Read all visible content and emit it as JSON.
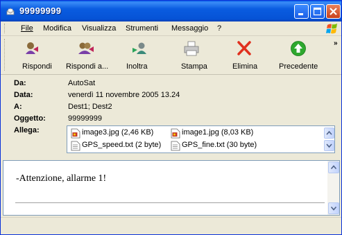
{
  "window": {
    "title": "99999999",
    "icon": "envelope-icon",
    "controls": [
      "minimize-icon",
      "maximize-icon",
      "close-icon"
    ]
  },
  "menu": {
    "items": [
      "File",
      "Modifica",
      "Visualizza",
      "Strumenti",
      "Messaggio",
      "?"
    ]
  },
  "toolbar": {
    "buttons": [
      {
        "label": "Rispondi",
        "icon": "reply-icon"
      },
      {
        "label": "Rispondi a...",
        "icon": "reply-all-icon"
      },
      {
        "label": "Inoltra",
        "icon": "forward-icon"
      },
      {
        "label": "Stampa",
        "icon": "printer-icon"
      },
      {
        "label": "Elimina",
        "icon": "delete-x-icon"
      },
      {
        "label": "Precedente",
        "icon": "previous-arrow-icon"
      }
    ],
    "overflow": "»"
  },
  "header": {
    "from_label": "Da:",
    "from_value": "AutoSat",
    "date_label": "Data:",
    "date_value": "venerdì 11 novembre 2005 13.24",
    "to_label": "A:",
    "to_value": "Dest1; Dest2",
    "subject_label": "Oggetto:",
    "subject_value": "99999999",
    "attach_label": "Allega:"
  },
  "attachments": [
    {
      "name": "image3.jpg (2,46 KB)",
      "icon": "image-file-icon"
    },
    {
      "name": "image1.jpg (8,03 KB)",
      "icon": "image-file-icon"
    },
    {
      "name": "GPS_speed.txt (2 byte)",
      "icon": "text-file-icon"
    },
    {
      "name": "GPS_fine.txt (30 byte)",
      "icon": "text-file-icon"
    }
  ],
  "message": {
    "body": "-Attenzione, allarme 1!"
  },
  "colors": {
    "titlebar": "#0a5ce0",
    "chrome": "#ece9d8",
    "close_button": "#c8411d",
    "delete_icon": "#e0301e",
    "previous_icon": "#2ea82e"
  }
}
